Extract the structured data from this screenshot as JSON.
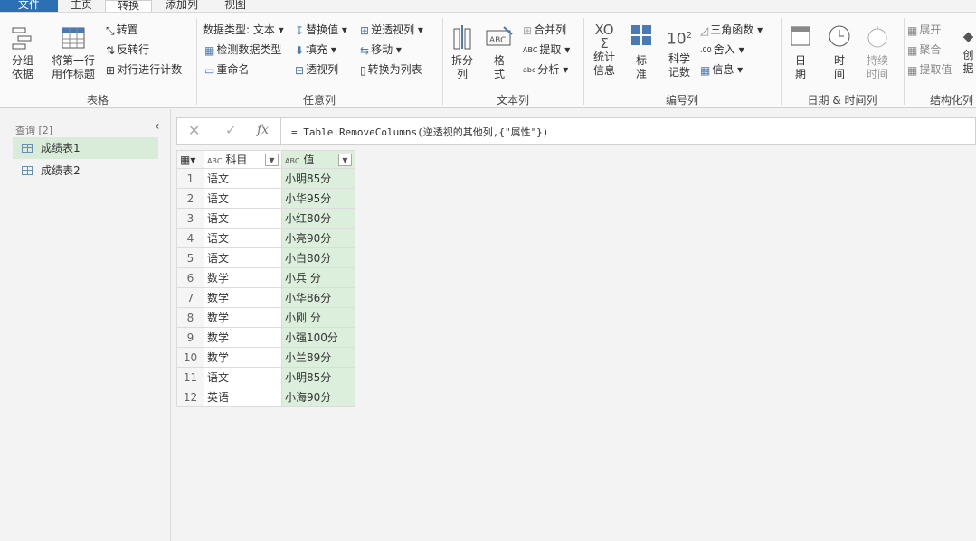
{
  "menu": {
    "tabs": [
      "文件",
      "主页",
      "转换",
      "添加列",
      "视图"
    ],
    "active": "转换"
  },
  "ribbon": {
    "groups": {
      "table": {
        "label": "表格",
        "group_by": "分组\n依据",
        "use_first_row": "将第一行\n用作标题",
        "transpose": "转置",
        "reverse_rows": "反转行",
        "count_rows": "对行进行计数"
      },
      "any_column": {
        "label": "任意列",
        "data_type": "数据类型: 文本",
        "detect_type": "检测数据类型",
        "rename": "重命名",
        "replace_values": "替换值",
        "fill": "填充",
        "pivot": "透视列",
        "unpivot": "逆透视列",
        "move": "移动",
        "to_list": "转换为列表"
      },
      "text_column": {
        "label": "文本列",
        "split": "拆分\n列",
        "format": "格\n式",
        "merge": "合并列",
        "extract": "提取",
        "parse": "分析"
      },
      "number_column": {
        "label": "编号列",
        "statistics": "统计\n信息",
        "standard": "标\n准",
        "scientific": "科学\n记数",
        "trig": "三角函数",
        "rounding": "舍入",
        "information": "信息"
      },
      "datetime_column": {
        "label": "日期 & 时间列",
        "date": "日\n期",
        "time": "时\n间",
        "duration": "持续\n时间"
      },
      "structured_column": {
        "label": "结构化列",
        "expand": "展开",
        "aggregate": "聚合",
        "extract_values": "提取值",
        "create": "创\n据"
      }
    }
  },
  "sidebar": {
    "header": "查询 [2]",
    "queries": [
      "成绩表1",
      "成绩表2"
    ],
    "selected": 0
  },
  "formula": {
    "text": "= Table.RemoveColumns(逆透视的其他列,{\"属性\"})"
  },
  "table": {
    "columns": [
      {
        "type": "ABC",
        "name": "科目"
      },
      {
        "type": "ABC",
        "name": "值"
      }
    ],
    "rows": [
      [
        "1",
        "语文",
        "小明85分"
      ],
      [
        "2",
        "语文",
        "小华95分"
      ],
      [
        "3",
        "语文",
        "小红80分"
      ],
      [
        "4",
        "语文",
        "小亮90分"
      ],
      [
        "5",
        "语文",
        "小白80分"
      ],
      [
        "6",
        "数学",
        "小兵 分"
      ],
      [
        "7",
        "数学",
        "小华86分"
      ],
      [
        "8",
        "数学",
        "小刚 分"
      ],
      [
        "9",
        "数学",
        "小强100分"
      ],
      [
        "10",
        "数学",
        "小兰89分"
      ],
      [
        "11",
        "语文",
        "小明85分"
      ],
      [
        "12",
        "英语",
        "小海90分"
      ]
    ]
  },
  "colors": {
    "file_tab": "#2b6fb5",
    "selected_green": "#dcefdc",
    "icon_blue": "#4a7ab5"
  }
}
